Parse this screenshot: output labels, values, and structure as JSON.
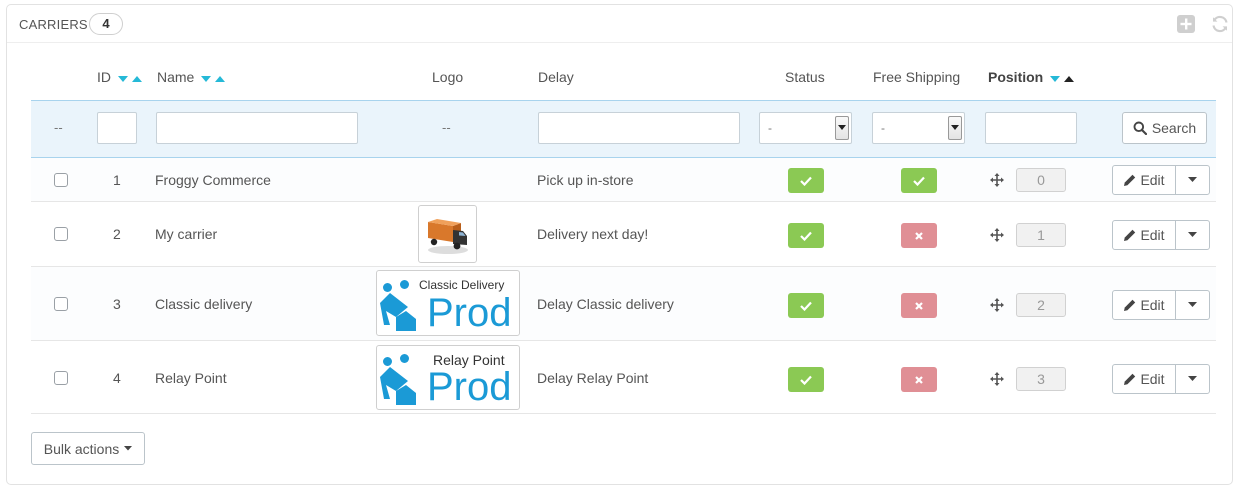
{
  "panel": {
    "title": "Carriers",
    "count": "4"
  },
  "columns": {
    "id": "ID",
    "name": "Name",
    "logo": "Logo",
    "delay": "Delay",
    "status": "Status",
    "free_shipping": "Free Shipping",
    "position": "Position"
  },
  "filters": {
    "select_dash": "--",
    "logo_dash": "--",
    "status_value": "-",
    "free_shipping_value": "-",
    "search_label": "Search"
  },
  "rows": [
    {
      "id": "1",
      "name": "Froggy Commerce",
      "delay": "Pick up in-store",
      "status": "enabled",
      "free_shipping": "yes",
      "position": "0",
      "logo": ""
    },
    {
      "id": "2",
      "name": "My carrier",
      "delay": "Delivery next day!",
      "status": "enabled",
      "free_shipping": "no",
      "position": "1",
      "logo": "truck"
    },
    {
      "id": "3",
      "name": "Classic delivery",
      "delay": "Delay Classic delivery",
      "status": "enabled",
      "free_shipping": "no",
      "position": "2",
      "logo": {
        "caption": "Classic Delivery",
        "brand": "Prod"
      }
    },
    {
      "id": "4",
      "name": "Relay Point",
      "delay": "Delay Relay Point",
      "status": "enabled",
      "free_shipping": "no",
      "position": "3",
      "logo": {
        "caption": "Relay Point",
        "brand": "Prod"
      }
    }
  ],
  "row_actions": {
    "edit_label": "Edit"
  },
  "footer": {
    "bulk_actions_label": "Bulk actions"
  },
  "colors": {
    "enabled": "#8bc954",
    "disabled": "#e08f95",
    "sort_active": "#25b9d7",
    "logo_brand": "#1b9ad6"
  }
}
